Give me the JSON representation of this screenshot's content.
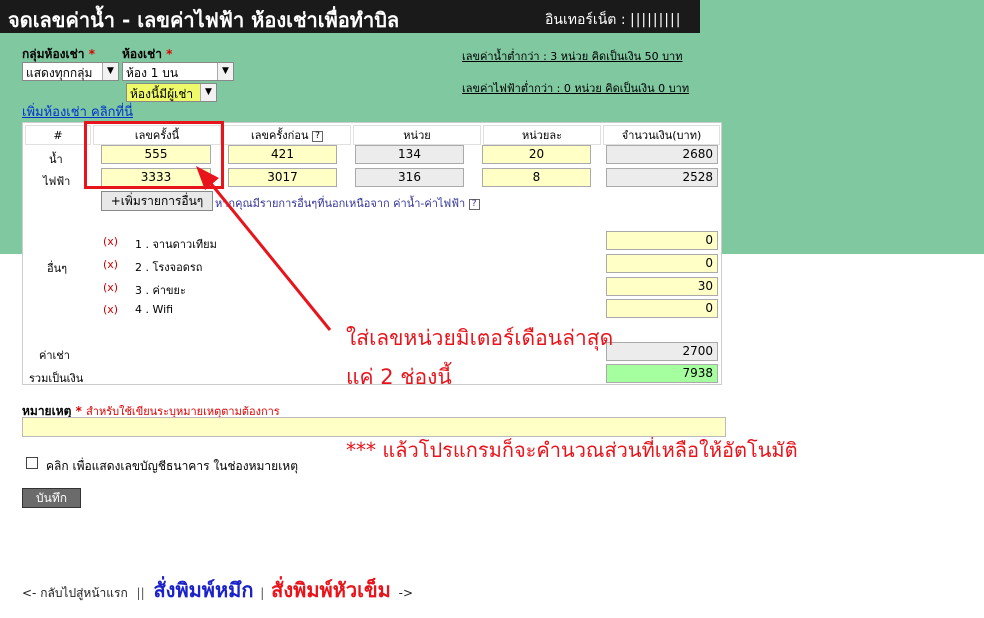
{
  "header": {
    "title": "จดเลขค่าน้ำ - เลขค่าไฟฟ้า ห้องเช่าเพื่อทำบิล",
    "internet_label": "อินเทอร์เน็ต :",
    "internet_value": "|||||||||"
  },
  "filters": {
    "group_label": "กลุ่มห้องเช่า",
    "group_value": "แสดงทุกกลุ่ม",
    "room_label": "ห้องเช่า",
    "room_value": "ห้อง 1 บน",
    "occupancy_value": "ห้องนี้มีผู้เช่า",
    "required_mark": "*",
    "add_room_link": "เพิ่มห้องเช่า คลิกที่นี่"
  },
  "rates": {
    "water_min": "เลขค่าน้ำต่ำกว่า : 3 หน่วย คิดเป็นเงิน 50 บาท",
    "electric_min": "เลขค่าไฟฟ้าต่ำกว่า : 0 หน่วย คิดเป็นเงิน 0 บาท"
  },
  "table": {
    "headers": [
      "#",
      "เลขครั้งนี้",
      "เลขครั้งก่อน",
      "หน่วย",
      "หน่วยละ",
      "จำนวนเงิน(บาท)"
    ],
    "help_mark": "?",
    "water": {
      "label": "น้ำ",
      "current": "555",
      "previous": "421",
      "units": "134",
      "rate": "20",
      "amount": "2680"
    },
    "electric": {
      "label": "ไฟฟ้า",
      "current": "3333",
      "previous": "3017",
      "units": "316",
      "rate": "8",
      "amount": "2528"
    },
    "others": {
      "label": "อื่นๆ",
      "add_button": "+เพิ่มรายการอื่นๆ",
      "hint": "หากคุณมีรายการอื่นๆที่นอกเหนือจาก ค่าน้ำ-ค่าไฟฟ้า",
      "delete_mark": "(x)",
      "items": [
        {
          "name": "1 . จานดาวเทียม",
          "amount": "0"
        },
        {
          "name": "2 . โรงจอดรถ",
          "amount": "0"
        },
        {
          "name": "3 . ค่าขยะ",
          "amount": "30"
        },
        {
          "name": "4 . Wifi",
          "amount": "0"
        }
      ]
    },
    "rent": {
      "label": "ค่าเช่า",
      "amount": "2700"
    },
    "total": {
      "label": "รวมเป็นเงิน",
      "amount": "7938"
    }
  },
  "annotations": {
    "line1": "ใส่เลขหน่วยมิเตอร์เดือนล่าสุด",
    "line2": "แค่ 2 ช่องนี้",
    "line3": "*** แล้วโปรแกรมก็จะคำนวณส่วนที่เหลือให้อัตโนมัติ",
    "color": "#e8141b"
  },
  "remark": {
    "label": "หมายเหตุ",
    "required_mark": "*",
    "hint": "สำหรับใช้เขียนระบุหมายเหตุตามต้องการ",
    "value": ""
  },
  "bank_checkbox": {
    "label": "คลิก เพื่อแสดงเลขบัญชีธนาคาร ในช่องหมายเหตุ",
    "checked": false
  },
  "save_button": "บันทึก",
  "footer": {
    "back_link": "<- กลับไปสู่หน้าแรก",
    "separator": "||",
    "print_ink": "สั่งพิมพ์หมึก",
    "pipe": "|",
    "print_dot": "สั่งพิมพ์หัวเข็ม",
    "arrow": "->"
  },
  "colors": {
    "top_band": "#7fc8a0",
    "header_bar": "#1a1a1a",
    "input_yellow": "#ffffc6",
    "total_green": "#a6ff9f"
  }
}
